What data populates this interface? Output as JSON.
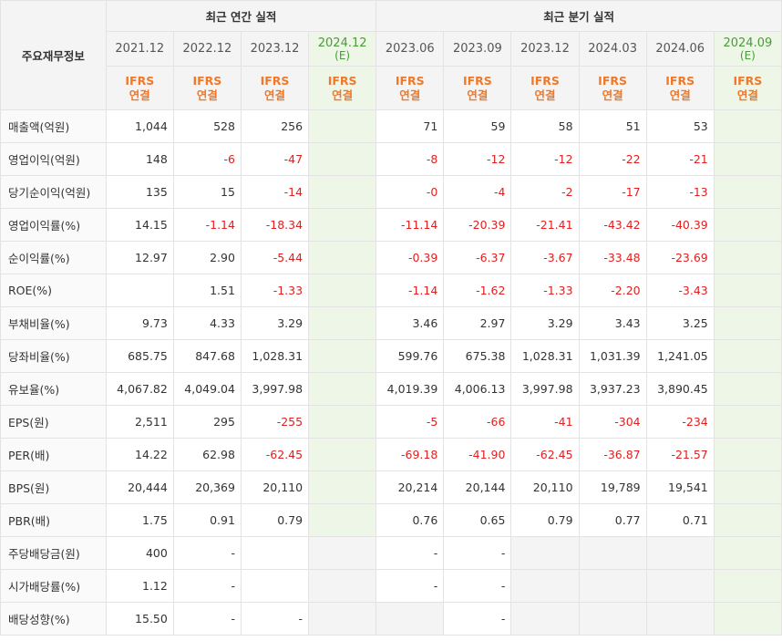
{
  "header": {
    "row_label": "주요재무정보",
    "annual_title": "최근 연간 실적",
    "quarter_title": "최근 분기 실적",
    "periods": [
      {
        "label": "2021.12",
        "est": ""
      },
      {
        "label": "2022.12",
        "est": ""
      },
      {
        "label": "2023.12",
        "est": ""
      },
      {
        "label": "2024.12",
        "est": "(E)"
      },
      {
        "label": "2023.06",
        "est": ""
      },
      {
        "label": "2023.09",
        "est": ""
      },
      {
        "label": "2023.12",
        "est": ""
      },
      {
        "label": "2024.03",
        "est": ""
      },
      {
        "label": "2024.06",
        "est": ""
      },
      {
        "label": "2024.09",
        "est": "(E)"
      }
    ],
    "ifrs_line1": "IFRS",
    "ifrs_line2": "연결"
  },
  "colors": {
    "negative": "#e02020",
    "ifrs": "#f07828",
    "estimate_bg": "#eef6e8",
    "estimate_text": "#4a9a3a"
  },
  "rows": [
    {
      "label": "매출액(억원)",
      "values": [
        "1,044",
        "528",
        "256",
        "",
        "71",
        "59",
        "58",
        "51",
        "53",
        ""
      ]
    },
    {
      "label": "영업이익(억원)",
      "values": [
        "148",
        "-6",
        "-47",
        "",
        "-8",
        "-12",
        "-12",
        "-22",
        "-21",
        ""
      ]
    },
    {
      "label": "당기순이익(억원)",
      "values": [
        "135",
        "15",
        "-14",
        "",
        "-0",
        "-4",
        "-2",
        "-17",
        "-13",
        ""
      ]
    },
    {
      "label": "영업이익률(%)",
      "values": [
        "14.15",
        "-1.14",
        "-18.34",
        "",
        "-11.14",
        "-20.39",
        "-21.41",
        "-43.42",
        "-40.39",
        ""
      ]
    },
    {
      "label": "순이익률(%)",
      "values": [
        "12.97",
        "2.90",
        "-5.44",
        "",
        "-0.39",
        "-6.37",
        "-3.67",
        "-33.48",
        "-23.69",
        ""
      ]
    },
    {
      "label": "ROE(%)",
      "values": [
        "",
        "1.51",
        "-1.33",
        "",
        "-1.14",
        "-1.62",
        "-1.33",
        "-2.20",
        "-3.43",
        ""
      ]
    },
    {
      "label": "부채비율(%)",
      "values": [
        "9.73",
        "4.33",
        "3.29",
        "",
        "3.46",
        "2.97",
        "3.29",
        "3.43",
        "3.25",
        ""
      ]
    },
    {
      "label": "당좌비율(%)",
      "values": [
        "685.75",
        "847.68",
        "1,028.31",
        "",
        "599.76",
        "675.38",
        "1,028.31",
        "1,031.39",
        "1,241.05",
        ""
      ]
    },
    {
      "label": "유보율(%)",
      "values": [
        "4,067.82",
        "4,049.04",
        "3,997.98",
        "",
        "4,019.39",
        "4,006.13",
        "3,997.98",
        "3,937.23",
        "3,890.45",
        ""
      ]
    },
    {
      "label": "EPS(원)",
      "values": [
        "2,511",
        "295",
        "-255",
        "",
        "-5",
        "-66",
        "-41",
        "-304",
        "-234",
        ""
      ]
    },
    {
      "label": "PER(배)",
      "values": [
        "14.22",
        "62.98",
        "-62.45",
        "",
        "-69.18",
        "-41.90",
        "-62.45",
        "-36.87",
        "-21.57",
        ""
      ]
    },
    {
      "label": "BPS(원)",
      "values": [
        "20,444",
        "20,369",
        "20,110",
        "",
        "20,214",
        "20,144",
        "20,110",
        "19,789",
        "19,541",
        ""
      ]
    },
    {
      "label": "PBR(배)",
      "values": [
        "1.75",
        "0.91",
        "0.79",
        "",
        "0.76",
        "0.65",
        "0.79",
        "0.77",
        "0.71",
        ""
      ]
    },
    {
      "label": "주당배당금(원)",
      "values": [
        "400",
        "-",
        "",
        "",
        "-",
        "-",
        "",
        "",
        "",
        ""
      ]
    },
    {
      "label": "시가배당률(%)",
      "values": [
        "1.12",
        "-",
        "",
        "",
        "-",
        "-",
        "",
        "",
        "",
        ""
      ]
    },
    {
      "label": "배당성향(%)",
      "values": [
        "15.50",
        "-",
        "-",
        "",
        "",
        "-",
        "",
        "",
        "",
        ""
      ]
    }
  ]
}
